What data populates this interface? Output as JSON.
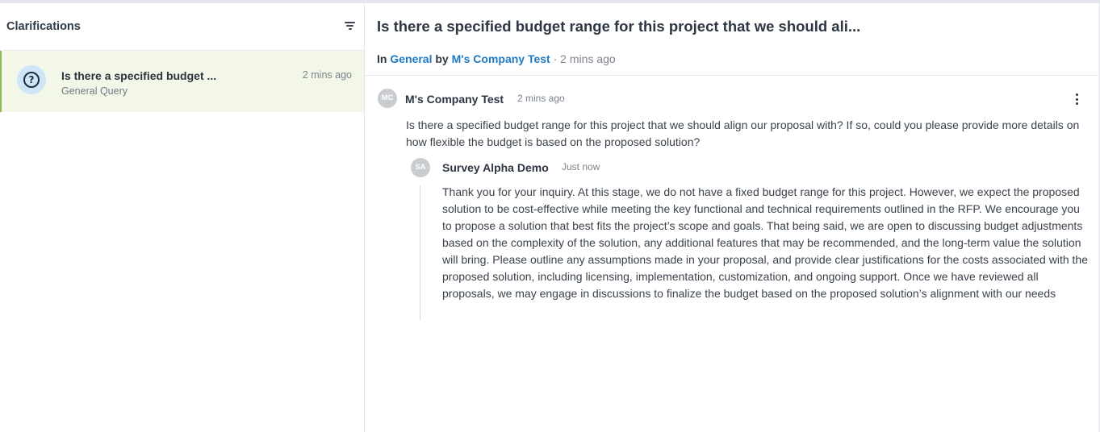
{
  "sidebar": {
    "title": "Clarifications",
    "filter_icon": "filter-icon",
    "threads": [
      {
        "title": "Is there a specified budget ...",
        "time": "2 mins ago",
        "category": "General Query",
        "icon": "question-circle-icon",
        "selected": true
      }
    ]
  },
  "thread": {
    "title": "Is there a specified budget range for this project that we should ali...",
    "meta": {
      "in_label": "In",
      "category": "General",
      "by_label": "by",
      "author": "M's Company Test",
      "separator": "·",
      "time": "2 mins ago"
    },
    "message": {
      "avatar_initials": "MC",
      "author": "M's Company Test",
      "time": "2 mins ago",
      "menu_icon": "more-vertical-icon",
      "body": "Is there a specified budget range for this project that we should align our proposal with? If so, could you please provide more details on how flexible the budget is based on the proposed solution?"
    },
    "reply": {
      "avatar_initials": "SA",
      "author": "Survey Alpha Demo",
      "time": "Just now",
      "body": "Thank you for your inquiry. At this stage, we do not have a fixed budget range for this project. However, we expect the proposed solution to be cost-effective while meeting the key functional and technical requirements outlined in the RFP. We encourage you to propose a solution that best fits the project’s scope and goals. That being said, we are open to discussing budget adjustments based on the complexity of the solution, any additional features that may be recommended, and the long-term value the solution will bring. Please outline any assumptions made in your proposal, and provide clear justifications for the costs associated with the proposed solution, including licensing, implementation, customization, and ongoing support. Once we have reviewed all proposals, we may engage in discussions to finalize the budget based on the proposed solution’s alignment with our needs"
    }
  },
  "colors": {
    "link": "#1f7ac3",
    "selected_bg": "#f2f7e8",
    "selected_accent": "#8dbb59",
    "avatar_bg": "#cfe5f8"
  }
}
